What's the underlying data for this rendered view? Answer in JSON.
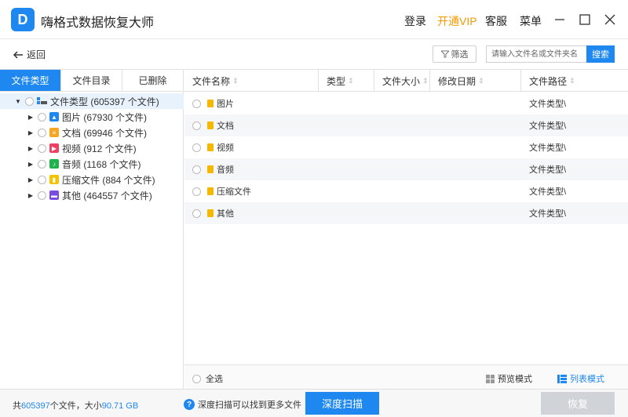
{
  "app": {
    "title": "嗨格式数据恢复大师",
    "logo_glyph": "D",
    "brand_color": "#1e88f0"
  },
  "titlebar": {
    "login": "登录",
    "vip": "开通VIP",
    "service": "客服",
    "menu": "菜单",
    "minimize_icon": "─",
    "maximize_icon": "☐",
    "close_icon": "✕"
  },
  "toolbar": {
    "back_label": "返回",
    "filter_label": "筛选",
    "search_placeholder": "请输入文件名或文件夹名",
    "search_button": "搜索"
  },
  "left_tabs": [
    {
      "label": "文件类型",
      "active": true
    },
    {
      "label": "文件目录",
      "active": false
    },
    {
      "label": "已删除",
      "active": false
    }
  ],
  "tree": {
    "root": {
      "label": "文件类型 (605397 个文件)"
    },
    "children": [
      {
        "label": "图片 (67930 个文件)",
        "icon": "image-icon",
        "color": "#1e88f0"
      },
      {
        "label": "文档 (69946 个文件)",
        "icon": "document-icon",
        "color": "#f5a623"
      },
      {
        "label": "视频 (912 个文件)",
        "icon": "video-icon",
        "color": "#f04060"
      },
      {
        "label": "音频 (1168 个文件)",
        "icon": "audio-icon",
        "color": "#22b24c"
      },
      {
        "label": "压缩文件 (884 个文件)",
        "icon": "archive-icon",
        "color": "#f5c400"
      },
      {
        "label": "其他 (464557 个文件)",
        "icon": "other-icon",
        "color": "#7b4ce0"
      }
    ]
  },
  "table": {
    "headers": [
      "文件名称",
      "类型",
      "文件大小",
      "修改日期",
      "文件路径"
    ],
    "rows": [
      {
        "name": "图片",
        "path": "文件类型\\"
      },
      {
        "name": "文档",
        "path": "文件类型\\"
      },
      {
        "name": "视频",
        "path": "文件类型\\"
      },
      {
        "name": "音频",
        "path": "文件类型\\"
      },
      {
        "name": "压缩文件",
        "path": "文件类型\\"
      },
      {
        "name": "其他",
        "path": "文件类型\\"
      }
    ],
    "select_all": "全选",
    "preview_mode": "预览模式",
    "list_mode": "列表模式"
  },
  "footer": {
    "stat_prefix": "共",
    "file_count": "605397",
    "stat_mid": "个文件，大小",
    "total_size": "90.71 GB",
    "hint": "深度扫描可以找到更多文件",
    "deep_scan": "深度扫描",
    "recover": "恢复"
  }
}
